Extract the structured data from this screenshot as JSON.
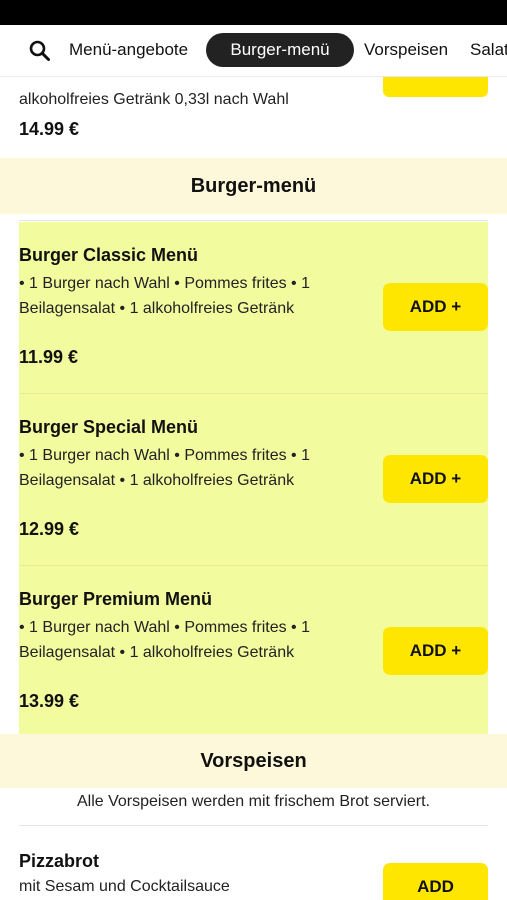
{
  "nav": {
    "tabs": [
      {
        "label": "Menü-angebote"
      },
      {
        "label": "Burger-menü",
        "active": true
      },
      {
        "label": "Vorspeisen"
      },
      {
        "label": "Salat"
      }
    ]
  },
  "previous_item": {
    "description": "alkoholfreies Getränk 0,33l nach Wahl",
    "price": "14.99 €"
  },
  "sections": [
    {
      "title": "Burger-menü",
      "items": [
        {
          "name": "Burger Classic Menü",
          "description": "• 1 Burger nach Wahl • Pommes frites • 1 Beilagensalat • 1 alkoholfreies Getränk",
          "price": "11.99 €",
          "add_label": "ADD +"
        },
        {
          "name": "Burger Special Menü",
          "description": "• 1 Burger nach Wahl • Pommes frites • 1 Beilagensalat • 1 alkoholfreies Getränk",
          "price": "12.99 €",
          "add_label": "ADD +"
        },
        {
          "name": "Burger Premium Menü",
          "description": "• 1 Burger nach Wahl • Pommes frites • 1 Beilagensalat • 1 alkoholfreies Getränk",
          "price": "13.99 €",
          "add_label": "ADD +"
        }
      ]
    },
    {
      "title": "Vorspeisen",
      "note": "Alle Vorspeisen werden mit frischem Brot serviert.",
      "items": [
        {
          "name": "Pizzabrot",
          "description": "mit Sesam und Cocktailsauce",
          "add_label": "ADD"
        }
      ]
    }
  ],
  "colors": {
    "accent": "#ffe600",
    "highlight": "#f2fb9e",
    "section_bg": "#fdf8da",
    "active_tab": "#222222"
  },
  "icons": {
    "search": "search-icon"
  }
}
